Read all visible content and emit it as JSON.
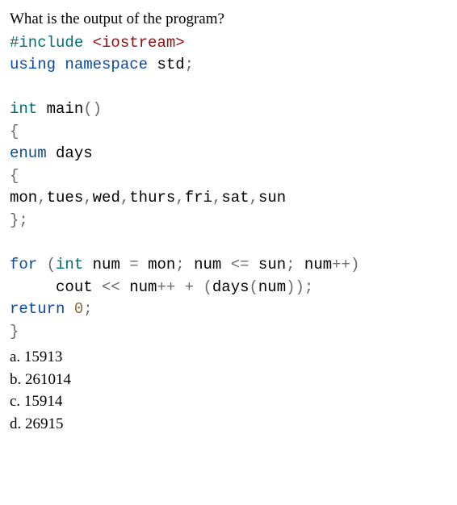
{
  "question": "What is the output of the program?",
  "code": {
    "l1": {
      "t1": "#include",
      "t2": " ",
      "t3": "<iostream>"
    },
    "l2": {
      "t1": "using",
      "t2": " ",
      "t3": "namespace",
      "t4": " std",
      "t5": ";"
    },
    "l3": "",
    "l4": {
      "t1": "int",
      "t2": " main",
      "t3": "()"
    },
    "l5": {
      "t1": "{"
    },
    "l6": {
      "t1": "enum",
      "t2": " days"
    },
    "l7": {
      "t1": "{"
    },
    "l8": {
      "t1": "mon",
      "t2": ",",
      "t3": "tues",
      "t4": ",",
      "t5": "wed",
      "t6": ",",
      "t7": "thurs",
      "t8": ",",
      "t9": "fri",
      "t10": ",",
      "t11": "sat",
      "t12": ",",
      "t13": "sun"
    },
    "l9": {
      "t1": "};"
    },
    "l10": "",
    "l11": {
      "t1": "for",
      "t2": " ",
      "t3": "(",
      "t4": "int",
      "t5": " num ",
      "t6": "=",
      "t7": " mon",
      "t8": ";",
      "t9": " num ",
      "t10": "<=",
      "t11": " sun",
      "t12": ";",
      "t13": " num",
      "t14": "++)"
    },
    "l12": {
      "t1": "     cout ",
      "t2": "<<",
      "t3": " num",
      "t4": "++",
      "t5": " ",
      "t6": "+",
      "t7": " ",
      "t8": "(",
      "t9": "days",
      "t10": "(",
      "t11": "num",
      "t12": "));"
    },
    "l13": {
      "t1": "return",
      "t2": " ",
      "t3": "0",
      "t4": ";"
    },
    "l14": {
      "t1": "}"
    }
  },
  "answers": {
    "a": "a. 15913",
    "b": "b. 261014",
    "c": "c. 15914",
    "d": "d. 26915"
  }
}
